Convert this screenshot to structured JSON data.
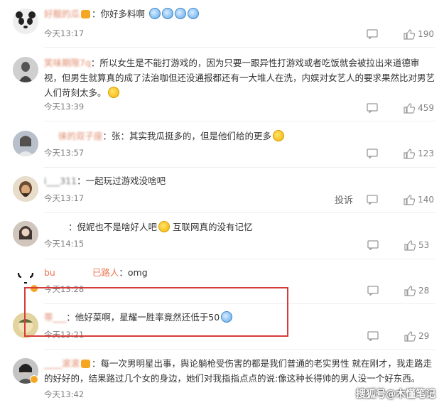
{
  "comments": [
    {
      "username": "好靓的瓜",
      "text": "你好多料啊",
      "time": "今天13:17",
      "likes": "190",
      "avatar_color": "#dcdcdc"
    },
    {
      "username": "笑味期限7q",
      "text": "所以女生是不能打游戏的，因为只要一跟异性打游戏或者吃饭就会被拉出来道德审视，但男生就算真的成了法治咖但还没通报都还有一大堆人在洗，内娱对女艺人的要求果然比对男艺人们苛刻太多。",
      "time": "今天13:39",
      "likes": "459",
      "avatar_color": "#7a7a7a"
    },
    {
      "username": "徕的双子座",
      "text": "张：其实我瓜挺多的，但是他们给的更多",
      "time": "今天13:57",
      "likes": "123",
      "avatar_color": "#9fa9b5"
    },
    {
      "username": "i___311",
      "text": "一起玩过游戏没啥吧",
      "time": "今天13:17",
      "likes": "140",
      "report": "投诉",
      "avatar_color": "#6b5a4a"
    },
    {
      "username": "",
      "text": "倪妮也不是啥好人吧",
      "text2": "互联网真的没有记忆",
      "time": "今天14:15",
      "likes": "53",
      "avatar_color": "#8a7f78"
    },
    {
      "username": "bu",
      "username_tail": "已路人",
      "text": "omg",
      "time": "今天13:28",
      "likes": "28",
      "avatar_color": "#ffffff"
    },
    {
      "username": "帯___",
      "text": "他好菜啊，星耀一胜率竟然还低于50",
      "time": "今天13:21",
      "likes": "29",
      "avatar_color": "#c9b58a"
    },
    {
      "username": "____滚滚",
      "text": "每一次男明星出事，舆论躺枪受伤害的都是我们普通的老实男性 就在刚才，我走路走的好好的，结果路过几个女的身边，她们对我指指点点的说:像这种长得帅的男人没一个好东西。",
      "time": "今天13:42",
      "avatar_color": "#6d6d6d"
    }
  ],
  "watermark": "搜狐号@木懂笔记"
}
